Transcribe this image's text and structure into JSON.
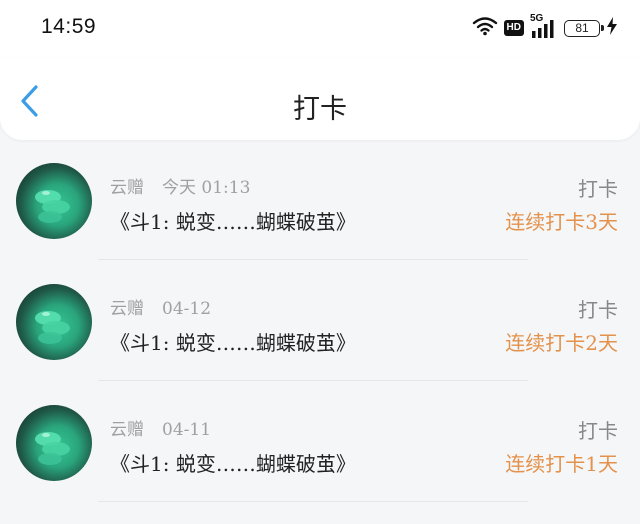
{
  "status_bar": {
    "time": "14:59",
    "hd": "HD",
    "network": "5G",
    "battery": "81",
    "icons": [
      "wifi-icon",
      "hd-icon",
      "5g-signal-icon",
      "battery-icon",
      "charging-icon"
    ]
  },
  "header": {
    "title": "打卡",
    "back_icon": "chevron-left-icon"
  },
  "colors": {
    "accent_blue": "#3a9de6",
    "streak_orange": "#e3914b"
  },
  "records": [
    {
      "user": "云赠",
      "date": "今天 01:13",
      "content": "《斗1: 蜕变……蝴蝶破茧》",
      "type": "打卡",
      "streak": "连续打卡3天"
    },
    {
      "user": "云赠",
      "date": "04-12",
      "content": "《斗1: 蜕变……蝴蝶破茧》",
      "type": "打卡",
      "streak": "连续打卡2天"
    },
    {
      "user": "云赠",
      "date": "04-11",
      "content": "《斗1: 蜕变……蝴蝶破茧》",
      "type": "打卡",
      "streak": "连续打卡1天"
    }
  ]
}
